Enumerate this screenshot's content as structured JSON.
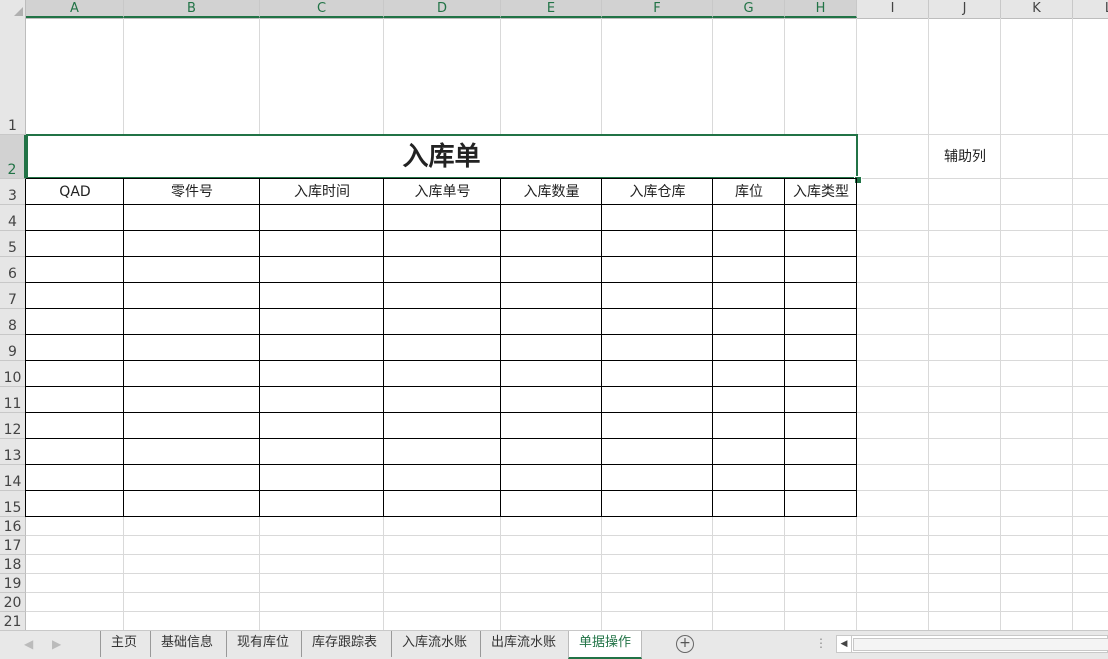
{
  "columns": [
    "A",
    "B",
    "C",
    "D",
    "E",
    "F",
    "G",
    "H",
    "I",
    "J",
    "K",
    "L"
  ],
  "rows": [
    "1",
    "2",
    "3",
    "4",
    "5",
    "6",
    "7",
    "8",
    "9",
    "10",
    "11",
    "12",
    "13",
    "14",
    "15",
    "16",
    "17",
    "18",
    "19",
    "20",
    "21"
  ],
  "title": "入库单",
  "helper_label": "辅助列",
  "table_headers": [
    "QAD",
    "零件号",
    "入库时间",
    "入库单号",
    "入库数量",
    "入库仓库",
    "库位",
    "入库类型"
  ],
  "sheet_tabs": [
    "主页",
    "基础信息",
    "现有库位",
    "库存跟踪表",
    "入库流水账",
    "出库流水账",
    "单据操作"
  ],
  "active_tab": "单据操作",
  "nav": {
    "prev": "◀",
    "next": "▶",
    "add": "+",
    "more": "⋮",
    "scroll_left": "◀"
  },
  "colors": {
    "accent": "#217346",
    "grid": "#d9d9d9",
    "header_bg": "#e6e6e6"
  }
}
